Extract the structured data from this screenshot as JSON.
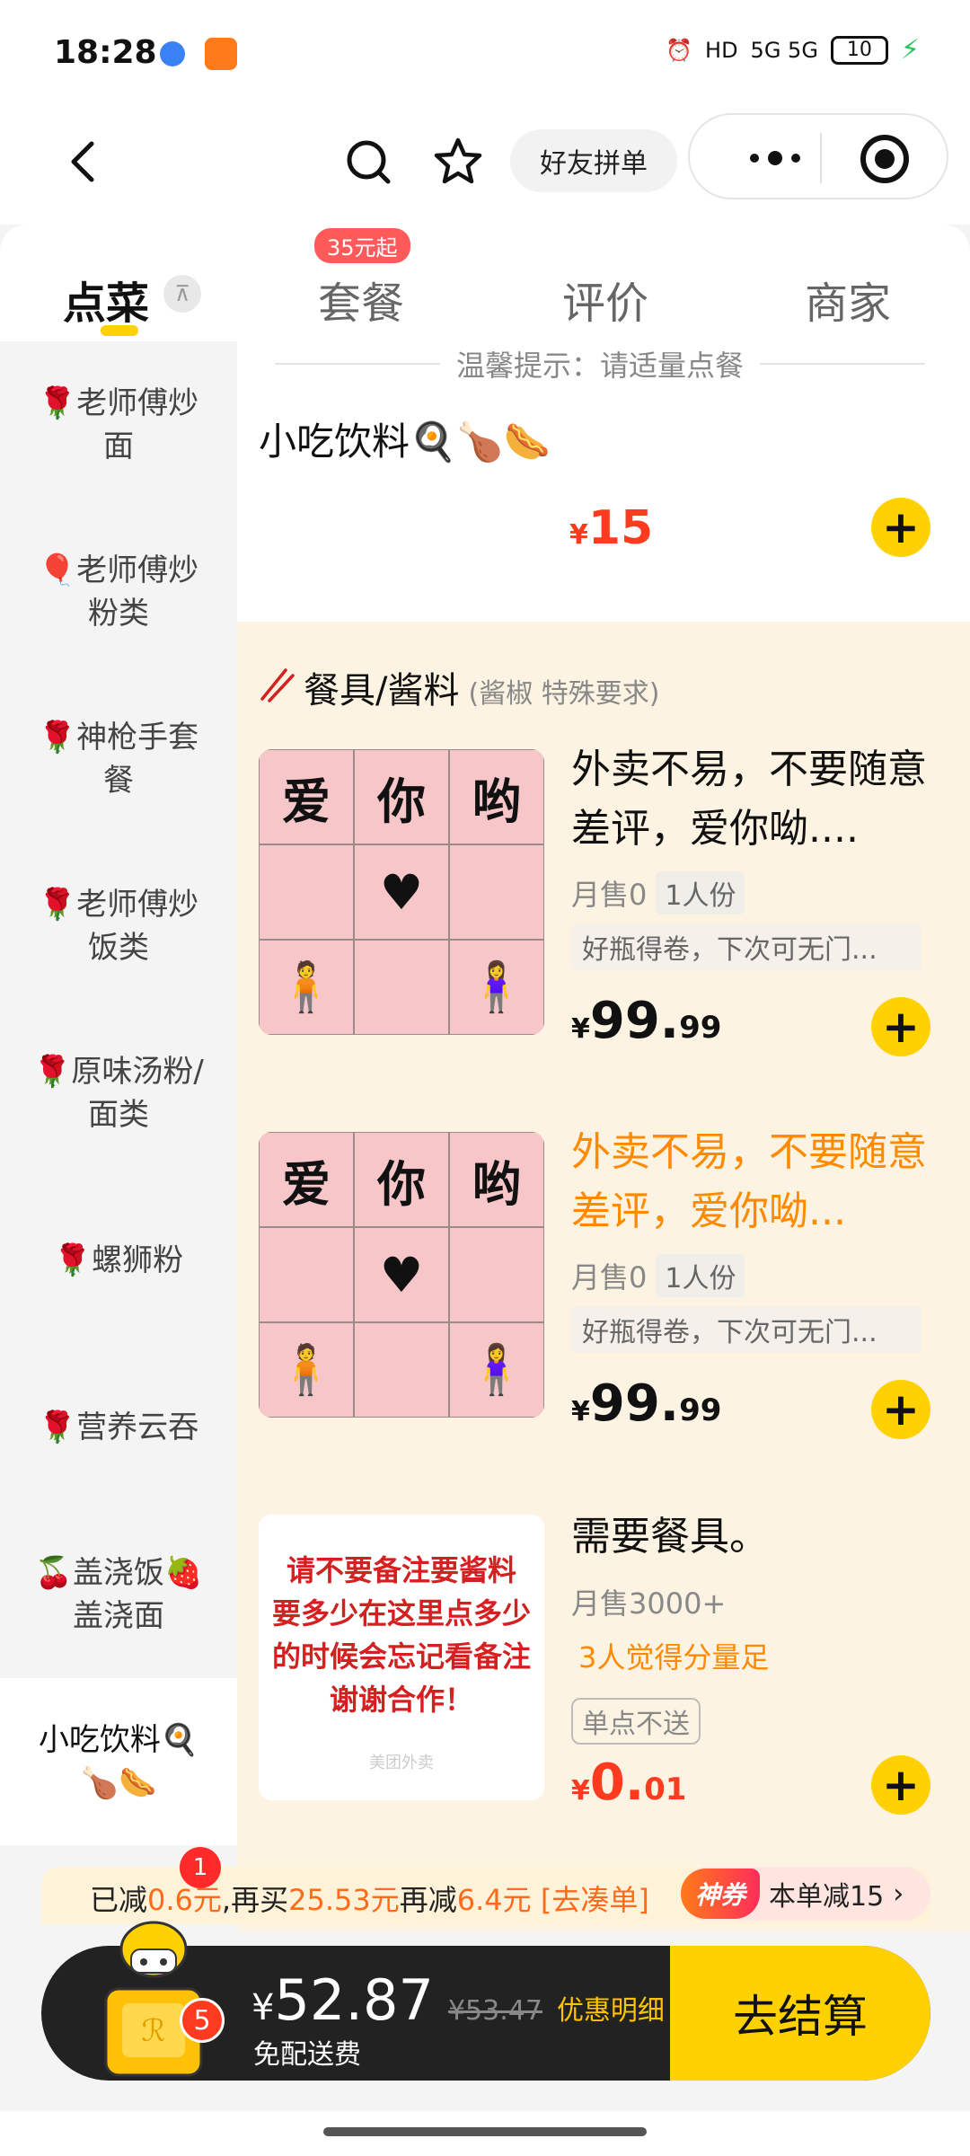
{
  "status_bar": {
    "time": "18:28",
    "network": "5G 5G",
    "hd_label": "HD",
    "battery": "10"
  },
  "nav": {
    "friend_button": "好友拼单"
  },
  "tabs": [
    {
      "label": "点菜"
    },
    {
      "label": "套餐",
      "badge": "35元起"
    },
    {
      "label": "评价"
    },
    {
      "label": "商家"
    }
  ],
  "sidebar": {
    "items": [
      {
        "label": "🌹老师傅炒面"
      },
      {
        "label": "🎈老师傅炒粉类"
      },
      {
        "label": "🌹神枪手套餐"
      },
      {
        "label": "🌹老师傅炒饭类"
      },
      {
        "label": "🌹原味汤粉/面类"
      },
      {
        "label": "🌹螺狮粉"
      },
      {
        "label": "🌹营养云吞"
      },
      {
        "label": "🍒盖浇饭🍓盖浇面"
      },
      {
        "label": "小吃饮料🍳🍗🌭",
        "active": true
      }
    ]
  },
  "content": {
    "tip": "温馨提示：请适量点餐",
    "first_item": {
      "name": "小吃饮料🍳🍗🌭",
      "currency": "¥",
      "price": "15"
    },
    "section": {
      "title": "餐具/酱料",
      "subtitle": "(酱椒 特殊要求)"
    },
    "picture_grid": {
      "top_left": "爱",
      "top_middle": "你",
      "top_right": "哟"
    },
    "foods": [
      {
        "name": "外卖不易，不要随意差评，爱你呦....",
        "sales": "月售0",
        "portion": "1人份",
        "tag": "好瓶得卷，下次可无门...",
        "currency": "¥",
        "price_int": "99.",
        "price_dec": "99"
      },
      {
        "name": "外卖不易，不要随意差评，爱你呦...",
        "sales": "月售0",
        "portion": "1人份",
        "tag": "好瓶得卷，下次可无门...",
        "currency": "¥",
        "price_int": "99.",
        "price_dec": "99"
      },
      {
        "name": "需要餐具。",
        "sales": "月售3000+",
        "note": "3人觉得分量足",
        "single": "单点不送",
        "currency": "¥",
        "price_int": "0.",
        "price_dec": "01",
        "image_lines": [
          "请不要备注要酱料",
          "要多少在这里点多少",
          "的时候会忘记看备注",
          "谢谢合作！"
        ],
        "image_watermark": "美团外卖"
      }
    ]
  },
  "promo": {
    "prefix": "已减",
    "reduced": "0.6元",
    "mid1": ",再买",
    "need": "25.53元",
    "mid2": "再减",
    "more": "6.4元",
    "link": "[去凑单]",
    "coupon_tag": "神券",
    "coupon_text": "本单减15",
    "cart_badge": "1"
  },
  "cart": {
    "currency": "¥",
    "total": "52.87",
    "original": "¥53.47",
    "detail": "优惠明细",
    "delivery": "免配送费",
    "count": "5",
    "checkout": "去结算"
  },
  "colors": {
    "accent_yellow": "#ffd100",
    "price_red": "#ff3b1f",
    "orange": "#ff8a00",
    "section_bg": "#fdf3e2"
  }
}
